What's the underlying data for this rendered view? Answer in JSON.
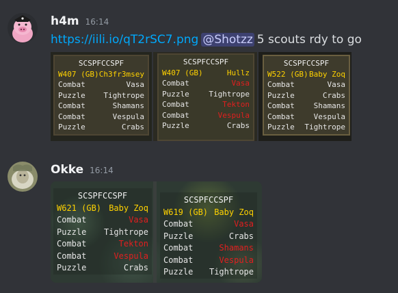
{
  "messages": [
    {
      "author": "h4m",
      "time": "16:14",
      "link": "https://iili.io/qT2rSC7.png",
      "mention": "@Shotzz",
      "text": "5 scouts rdy to go",
      "avatar_icon": "pig-avatar-icon",
      "panels": [
        {
          "header": "SCSPFCCSPF",
          "world": "W407 (GB)",
          "world_name": "Ch3fr3msey",
          "rows": [
            [
              "Combat",
              "Vasa",
              "w"
            ],
            [
              "Puzzle",
              "Tightrope",
              "w"
            ],
            [
              "Combat",
              "Shamans",
              "w"
            ],
            [
              "Combat",
              "Vespula",
              "w"
            ],
            [
              "Puzzle",
              "Crabs",
              "w"
            ]
          ]
        },
        {
          "header": "SCSPFCCSPF",
          "world": "W407 (GB)",
          "world_name": "Hullz",
          "rows": [
            [
              "Combat",
              "Vasa",
              "r"
            ],
            [
              "Puzzle",
              "Tightrope",
              "w"
            ],
            [
              "Combat",
              "Tekton",
              "r"
            ],
            [
              "Combat",
              "Vespula",
              "r"
            ],
            [
              "Puzzle",
              "Crabs",
              "w"
            ]
          ]
        },
        {
          "header": "SCSPFCCSPF",
          "world": "W522 (GB)",
          "world_name": "Baby Zoq",
          "rows": [
            [
              "Combat",
              "Vasa",
              "w"
            ],
            [
              "Puzzle",
              "Crabs",
              "w"
            ],
            [
              "Combat",
              "Shamans",
              "w"
            ],
            [
              "Combat",
              "Vespula",
              "w"
            ],
            [
              "Puzzle",
              "Tightrope",
              "w"
            ]
          ]
        }
      ]
    },
    {
      "author": "Okke",
      "time": "16:14",
      "avatar_icon": "sheep-avatar-icon",
      "panels": [
        {
          "header": "SCSPFCCSPF",
          "world": "W621 (GB)",
          "world_name": "Baby Zoq",
          "rows": [
            [
              "Combat",
              "Vasa",
              "r"
            ],
            [
              "Puzzle",
              "Tightrope",
              "w"
            ],
            [
              "Combat",
              "Tekton",
              "r"
            ],
            [
              "Combat",
              "Vespula",
              "r"
            ],
            [
              "Puzzle",
              "Crabs",
              "w"
            ]
          ]
        },
        {
          "header": "SCSPFCCSPF",
          "world": "W619 (GB)",
          "world_name": "Baby Zoq",
          "rows": [
            [
              "Combat",
              "Vasa",
              "r"
            ],
            [
              "Puzzle",
              "Crabs",
              "w"
            ],
            [
              "Combat",
              "Shamans",
              "r"
            ],
            [
              "Combat",
              "Vespula",
              "r"
            ],
            [
              "Puzzle",
              "Tightrope",
              "w"
            ]
          ]
        }
      ]
    }
  ],
  "colors": {
    "background": "#313338",
    "link": "#00a8fc",
    "overlay_yellow": "#ffd200",
    "overlay_red": "#e21f1f"
  }
}
